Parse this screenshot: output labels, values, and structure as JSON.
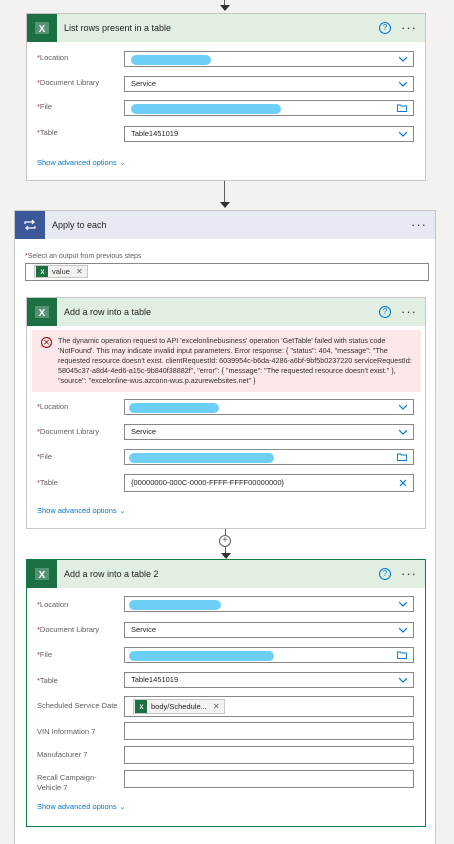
{
  "colors": {
    "accent": "#0078d4",
    "excel": "#1d7044",
    "error_bg": "#fde7e9",
    "required": "#a4262c",
    "selected_border": "#107c41"
  },
  "card1": {
    "title": "List rows present in a table",
    "fields": [
      {
        "label": "Location",
        "required": true,
        "value": "",
        "redacted": true,
        "control": "dropdown"
      },
      {
        "label": "Document Library",
        "required": true,
        "value": "Service",
        "control": "dropdown"
      },
      {
        "label": "File",
        "required": true,
        "value": "",
        "redacted": true,
        "control": "file-picker"
      },
      {
        "label": "Table",
        "required": true,
        "value": "Table1451019",
        "control": "dropdown"
      }
    ],
    "show_advanced": "Show advanced options"
  },
  "apply": {
    "title": "Apply to each",
    "select_label": "Select an output from previous steps",
    "token": "value"
  },
  "card2": {
    "title": "Add a row into a table",
    "error": "The dynamic operation request to API 'excelonlinebusiness' operation 'GetTable' failed with status code 'NotFound'. This may indicate invalid input parameters. Error response: { \"status\": 404, \"message\": \"The requested resource doesn't exist. clientRequestId: 6039954c-b6da-4286-a6bf-9bf5b0237220 serviceRequestId: 58045c37-a8d4-4ed6-a15c-9b840f38882f\", \"error\": { \"message\": \"The requested resource doesn't exist.\" }, \"source\": \"excelonline-wus.azconn-wus.p.azurewebsites.net\" }",
    "fields": [
      {
        "label": "Location",
        "required": true,
        "value": "",
        "redacted": true,
        "control": "dropdown"
      },
      {
        "label": "Document Library",
        "required": true,
        "value": "Service",
        "control": "dropdown"
      },
      {
        "label": "File",
        "required": true,
        "value": "",
        "redacted": true,
        "control": "file-picker"
      },
      {
        "label": "Table",
        "required": true,
        "value": "{00000000-000C-0000-FFFF-FFFF00000000}",
        "control": "clear"
      }
    ],
    "show_advanced": "Show advanced options"
  },
  "card3": {
    "title": "Add a row into a table 2",
    "fields": [
      {
        "label": "Location",
        "required": true,
        "value": "",
        "redacted": true,
        "control": "dropdown"
      },
      {
        "label": "Document Library",
        "required": true,
        "value": "Service",
        "control": "dropdown"
      },
      {
        "label": "File",
        "required": true,
        "value": "",
        "redacted": true,
        "control": "file-picker"
      },
      {
        "label": "Table",
        "required": true,
        "value": "Table1451019",
        "control": "dropdown"
      }
    ],
    "scheduled_label": "Scheduled Service Date",
    "scheduled_token": "body/Schedule...",
    "vin_label": "VIN Information 7",
    "manufacturer_label": "Manufacturer 7",
    "recall_label_1": "Recall Campaign-",
    "recall_label_2": "Vehicle 7",
    "show_advanced": "Show advanced options"
  },
  "icons": [
    "excel-icon",
    "help-icon",
    "more-options-icon",
    "loop-icon",
    "chevron-down-icon",
    "file-picker-icon",
    "clear-icon",
    "error-icon",
    "add-step-icon",
    "arrow-down-icon"
  ]
}
